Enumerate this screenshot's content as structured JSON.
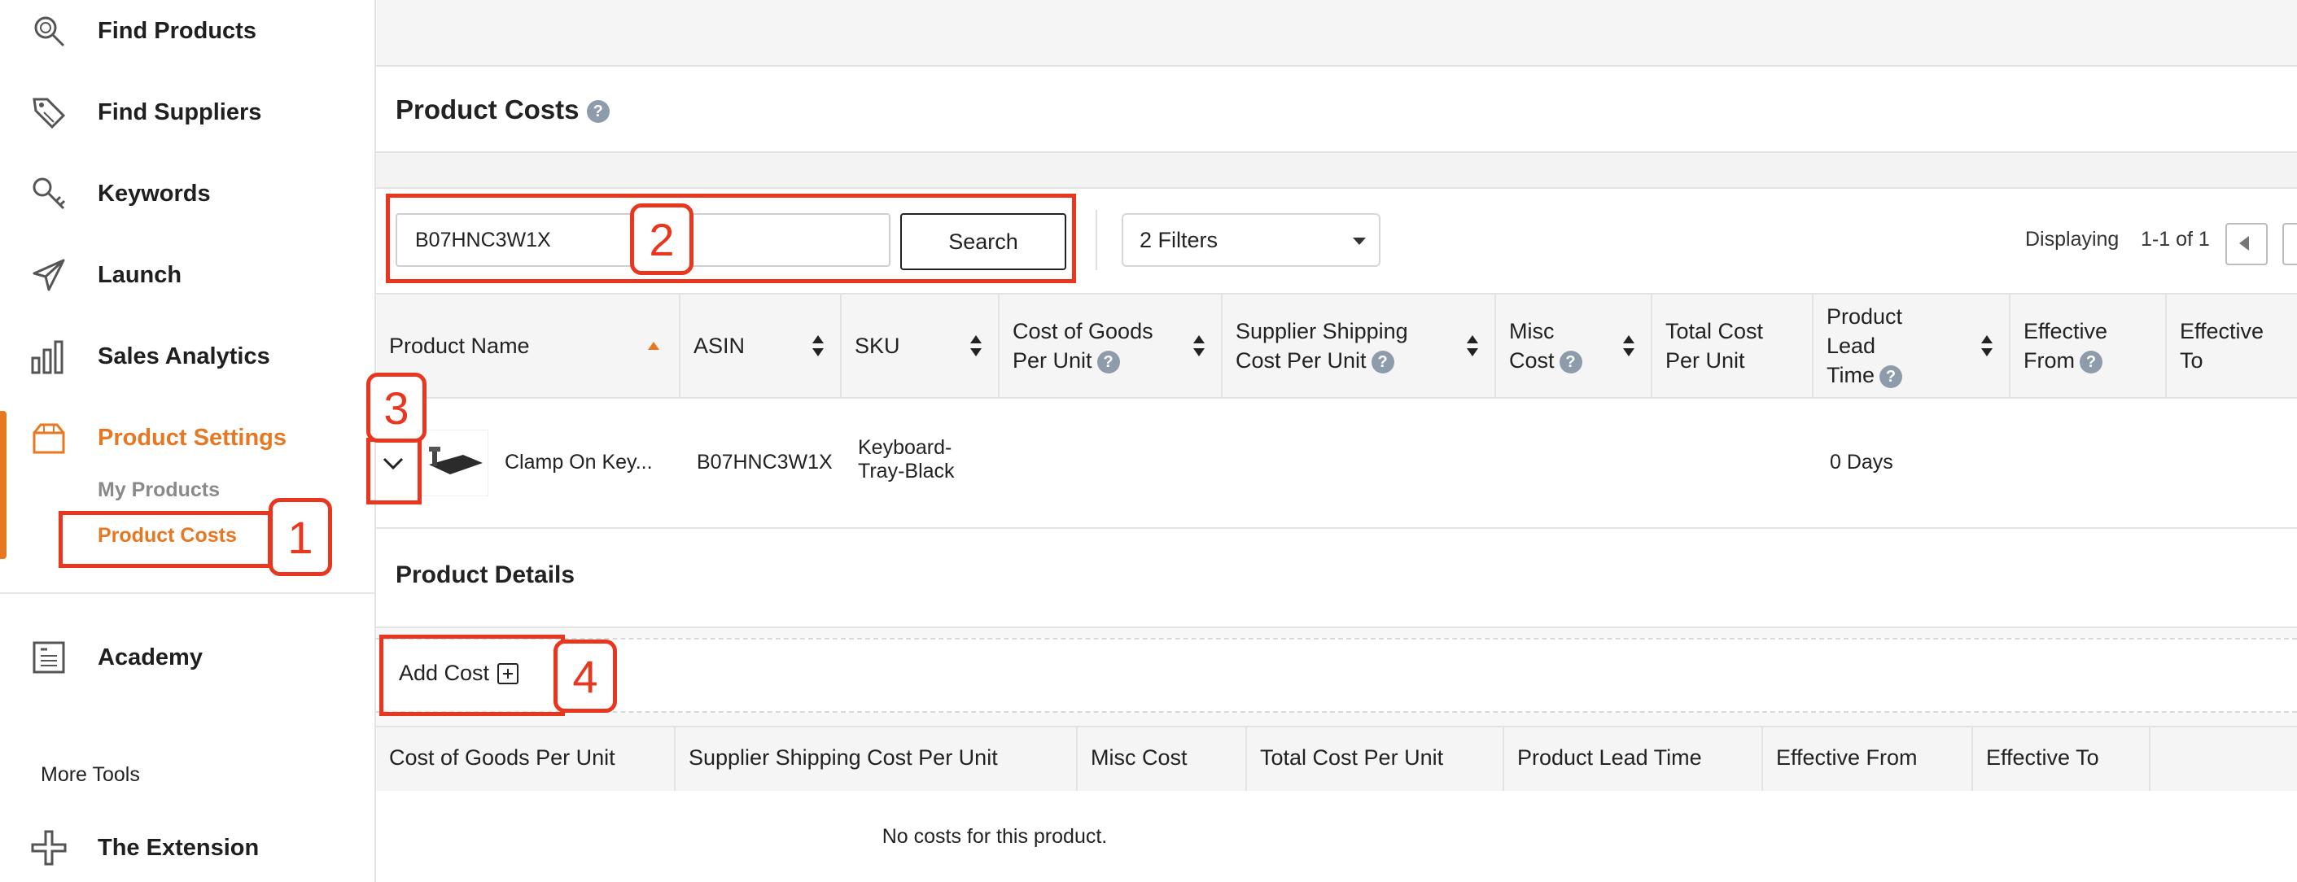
{
  "sidebar": {
    "items": [
      {
        "label": "Find Products",
        "icon": "search-icon"
      },
      {
        "label": "Find Suppliers",
        "icon": "tag-icon"
      },
      {
        "label": "Keywords",
        "icon": "key-icon"
      },
      {
        "label": "Launch",
        "icon": "paper-plane-icon"
      },
      {
        "label": "Sales Analytics",
        "icon": "bar-chart-icon"
      },
      {
        "label": "Product Settings",
        "icon": "box-icon"
      },
      {
        "label": "Academy",
        "icon": "book-icon"
      }
    ],
    "sub_items": [
      "My Products",
      "Product Costs"
    ],
    "more_tools_label": "More Tools",
    "extension": {
      "label": "The Extension",
      "icon": "puzzle-icon"
    },
    "accent_color": "#e87722"
  },
  "page": {
    "title": "Product Costs"
  },
  "toolbar": {
    "search_value": "B07HNC3W1X",
    "search_label": "Search",
    "filters_label": "2 Filters",
    "displaying_label": "Displaying",
    "range_label": "1-1 of 1"
  },
  "table": {
    "columns": [
      {
        "l1": "Product Name"
      },
      {
        "l1": "ASIN"
      },
      {
        "l1": "SKU"
      },
      {
        "l1": "Cost of Goods",
        "l2": "Per Unit"
      },
      {
        "l1": "Supplier Shipping",
        "l2": "Cost Per Unit"
      },
      {
        "l1": "Misc",
        "l2": "Cost"
      },
      {
        "l1": "Total Cost",
        "l2": "Per Unit"
      },
      {
        "l1": "Product",
        "l2": "Lead",
        "l3": "Time"
      },
      {
        "l1": "Effective",
        "l2": "From"
      },
      {
        "l1": "Effective",
        "l2": "To"
      }
    ],
    "rows": [
      {
        "product_name": "Clamp On Key...",
        "asin": "B07HNC3W1X",
        "sku_l1": "Keyboard-",
        "sku_l2": "Tray-Black",
        "lead_time": "0 Days"
      }
    ]
  },
  "details": {
    "title": "Product Details",
    "add_cost_label": "Add Cost",
    "columns": [
      "Cost of Goods Per Unit",
      "Supplier Shipping Cost Per Unit",
      "Misc Cost",
      "Total Cost Per Unit",
      "Product Lead Time",
      "Effective From",
      "Effective To"
    ],
    "empty_message": "No costs for this product."
  },
  "annotations": [
    "1",
    "2",
    "3",
    "4"
  ],
  "annotation_color": "#e8361f"
}
